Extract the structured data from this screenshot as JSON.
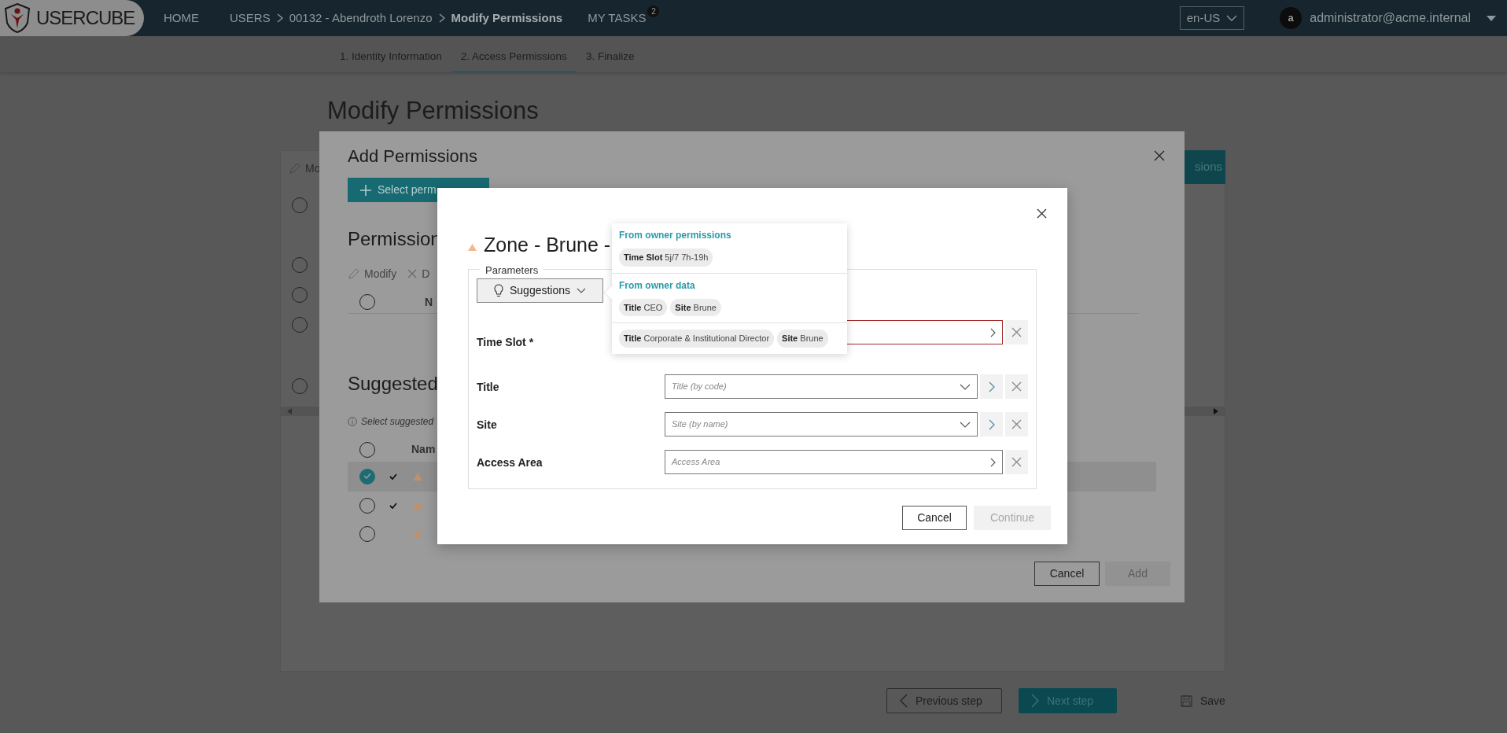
{
  "header": {
    "logo": "USERCUBE",
    "home": "HOME",
    "breadcrumb": [
      "USERS",
      "00132 - Abendroth Lorenzo",
      "Modify Permissions"
    ],
    "tasks": {
      "label": "MY TASKS",
      "count": "2"
    },
    "language": "en-US",
    "user": {
      "initial": "a",
      "email": "administrator@acme.internal"
    }
  },
  "steps": [
    {
      "label": "1. Identity Information",
      "selected": false
    },
    {
      "label": "2. Access Permissions",
      "selected": true
    },
    {
      "label": "3. Finalize",
      "selected": false
    }
  ],
  "page": {
    "title": "Modify Permissions",
    "toolbar_fragment": "Mo",
    "action_fragment": "sions",
    "radios": [
      {
        "selected": false
      },
      {
        "selected": false
      },
      {
        "selected": false
      },
      {
        "selected": false
      },
      {
        "selected": false
      }
    ],
    "footer": {
      "previous": "Previous step",
      "next": "Next step",
      "save": "Save"
    }
  },
  "add_dialog": {
    "title": "Add Permissions",
    "select_button": "Select perm",
    "permissions_heading": "Permission",
    "toolbar": [
      "Modify",
      "D"
    ],
    "column_fragment": "N",
    "permissions_all_selected": false,
    "suggested_heading": "Suggested",
    "info": "Select suggested",
    "name_column": "Nam",
    "all_selected": false,
    "rows": [
      {
        "selected": true,
        "approved": true
      },
      {
        "selected": false,
        "approved": true
      },
      {
        "selected": false,
        "approved": false
      }
    ],
    "cancel": "Cancel",
    "add": {
      "label": "Add",
      "disabled": true
    }
  },
  "param_dialog": {
    "title": "Zone - Brune -",
    "legend": "Parameters",
    "suggestions_button": "Suggestions",
    "fields": [
      {
        "label": "Time Slot *",
        "kind": "picker",
        "invalid": true
      },
      {
        "label": "Title",
        "kind": "combo",
        "placeholder": "Title (by code)",
        "invalid": false
      },
      {
        "label": "Site",
        "kind": "combo",
        "placeholder": "Site (by name)",
        "invalid": false
      },
      {
        "label": "Access Area",
        "kind": "picker",
        "placeholder": "Access Area",
        "invalid": false
      }
    ],
    "cancel": "Cancel",
    "continue": {
      "label": "Continue",
      "disabled": true
    }
  },
  "suggestions": [
    {
      "heading": "From owner permissions",
      "groups": [
        [
          "**Time Slot** 5j/7 7h-19h"
        ]
      ]
    },
    {
      "heading": "From owner data",
      "groups": [
        [
          "**Title** CEO",
          "**Site** Brune"
        ],
        [
          "**Title** Corporate & Institutional Director",
          "**Site** Brune"
        ]
      ]
    }
  ]
}
